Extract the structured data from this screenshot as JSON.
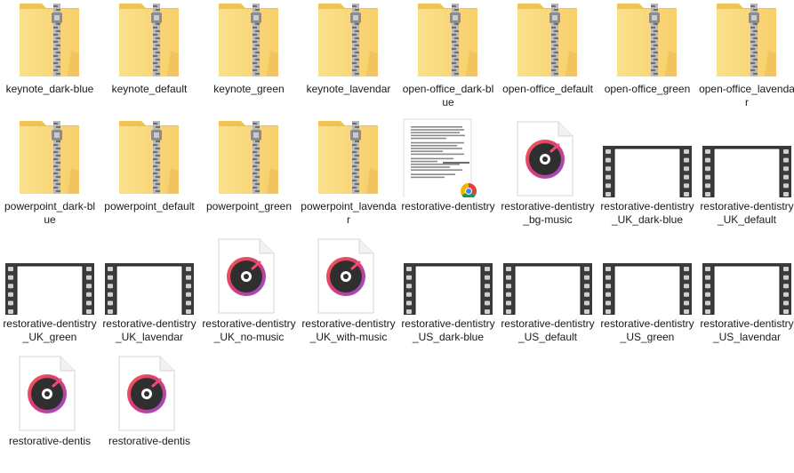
{
  "files": [
    {
      "name": "keynote_dark-blue",
      "type": "zip-folder"
    },
    {
      "name": "keynote_default",
      "type": "zip-folder"
    },
    {
      "name": "keynote_green",
      "type": "zip-folder"
    },
    {
      "name": "keynote_lavendar",
      "type": "zip-folder"
    },
    {
      "name": "open-office_dark-blue",
      "type": "zip-folder"
    },
    {
      "name": "open-office_default",
      "type": "zip-folder"
    },
    {
      "name": "open-office_green",
      "type": "zip-folder"
    },
    {
      "name": "open-office_lavendar",
      "type": "zip-folder"
    },
    {
      "name": "powerpoint_dark-blue",
      "type": "zip-folder"
    },
    {
      "name": "powerpoint_default",
      "type": "zip-folder"
    },
    {
      "name": "powerpoint_green",
      "type": "zip-folder"
    },
    {
      "name": "powerpoint_lavendar",
      "type": "zip-folder"
    },
    {
      "name": "restorative-dentistry",
      "type": "chrome-document"
    },
    {
      "name": "restorative-dentistry_bg-music",
      "type": "audio"
    },
    {
      "name": "restorative-dentistry_UK_dark-blue",
      "type": "video"
    },
    {
      "name": "restorative-dentistry_UK_default",
      "type": "video"
    },
    {
      "name": "restorative-dentistry_UK_green",
      "type": "video"
    },
    {
      "name": "restorative-dentistry_UK_lavendar",
      "type": "video"
    },
    {
      "name": "restorative-dentistry_UK_no-music",
      "type": "audio"
    },
    {
      "name": "restorative-dentistry_UK_with-music",
      "type": "audio"
    },
    {
      "name": "restorative-dentistry_US_dark-blue",
      "type": "video"
    },
    {
      "name": "restorative-dentistry_US_default",
      "type": "video"
    },
    {
      "name": "restorative-dentistry_US_green",
      "type": "video"
    },
    {
      "name": "restorative-dentistry_US_lavendar",
      "type": "video"
    },
    {
      "name": "restorative-dentis",
      "type": "audio"
    },
    {
      "name": "restorative-dentis",
      "type": "audio"
    }
  ],
  "colors": {
    "folder_back": "#e8b847",
    "folder_front": "#fcd77a",
    "zipper": "#9a9a9a",
    "audio_ring": "#e0446a",
    "audio_ring2": "#8a4fd8",
    "audio_disc": "#333333",
    "film_frame": "#3c3c3c",
    "text": "#1a1a1a"
  },
  "icons": {
    "zip-folder": "zip-folder-icon",
    "chrome-document": "document-chrome-icon",
    "audio": "audio-file-icon",
    "video": "video-file-icon"
  }
}
